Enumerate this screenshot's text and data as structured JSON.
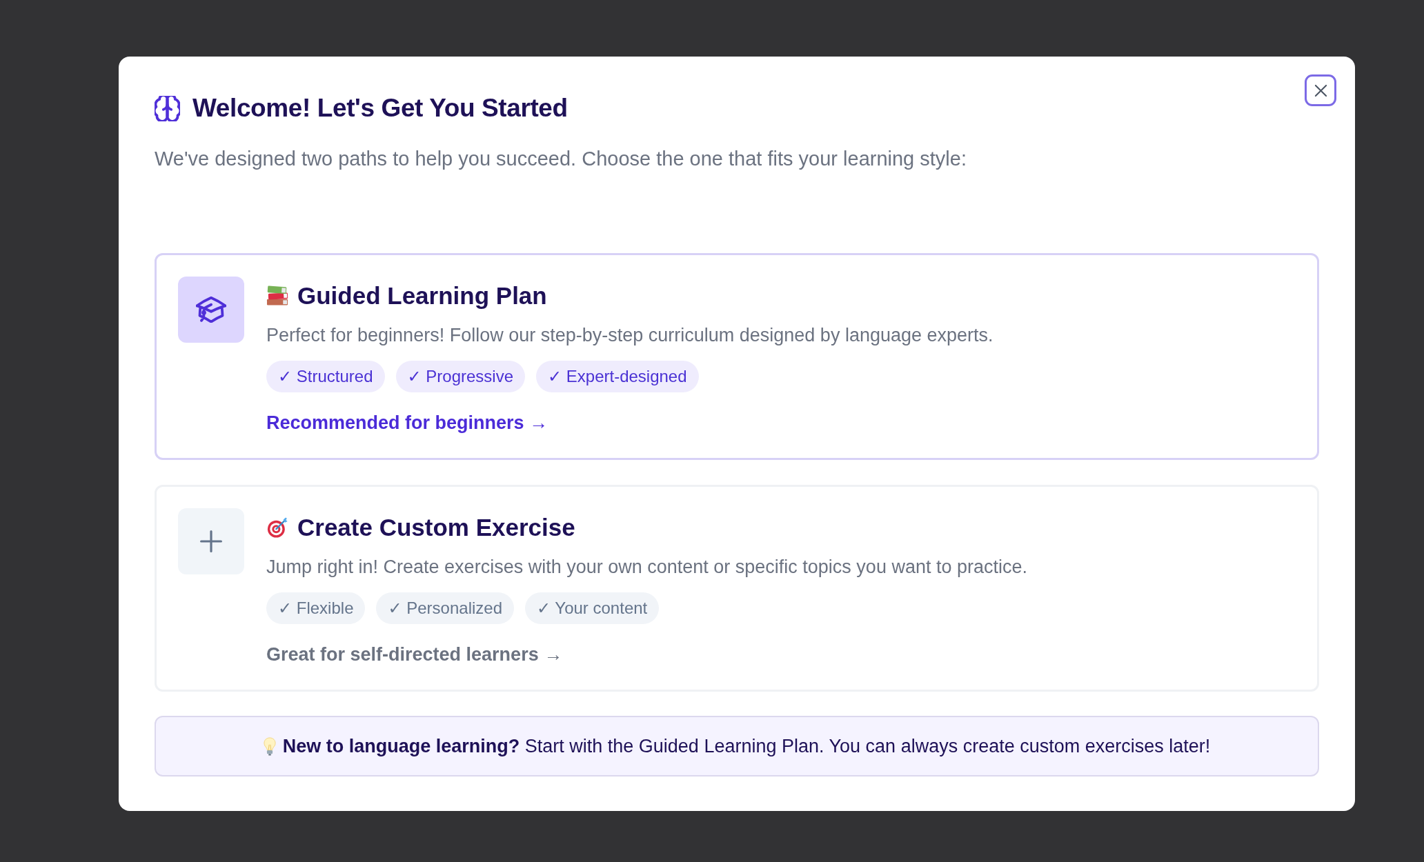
{
  "dialog": {
    "title": "Welcome! Let's Get You Started",
    "subtitle": "We've designed two paths to help you succeed. Choose the one that fits your learning style:",
    "paths": [
      {
        "kind": "guided",
        "selected": true,
        "title": "Guided Learning Plan",
        "description": "Perfect for beginners! Follow our step-by-step curriculum designed by language experts.",
        "tags": [
          "✓ Structured",
          "✓ Progressive",
          "✓ Expert-designed"
        ],
        "link": "Recommended for beginners →"
      },
      {
        "kind": "custom",
        "selected": false,
        "title": "Create Custom Exercise",
        "description": "Jump right in! Create exercises with your own content or specific topics you want to practice.",
        "tags": [
          "✓ Flexible",
          "✓ Personalized",
          "✓ Your content"
        ],
        "link": "Great for self-directed learners →"
      }
    ],
    "tip": "**New to language learning?** Start with the Guided Learning Plan. You can always create custom exercises later!"
  }
}
